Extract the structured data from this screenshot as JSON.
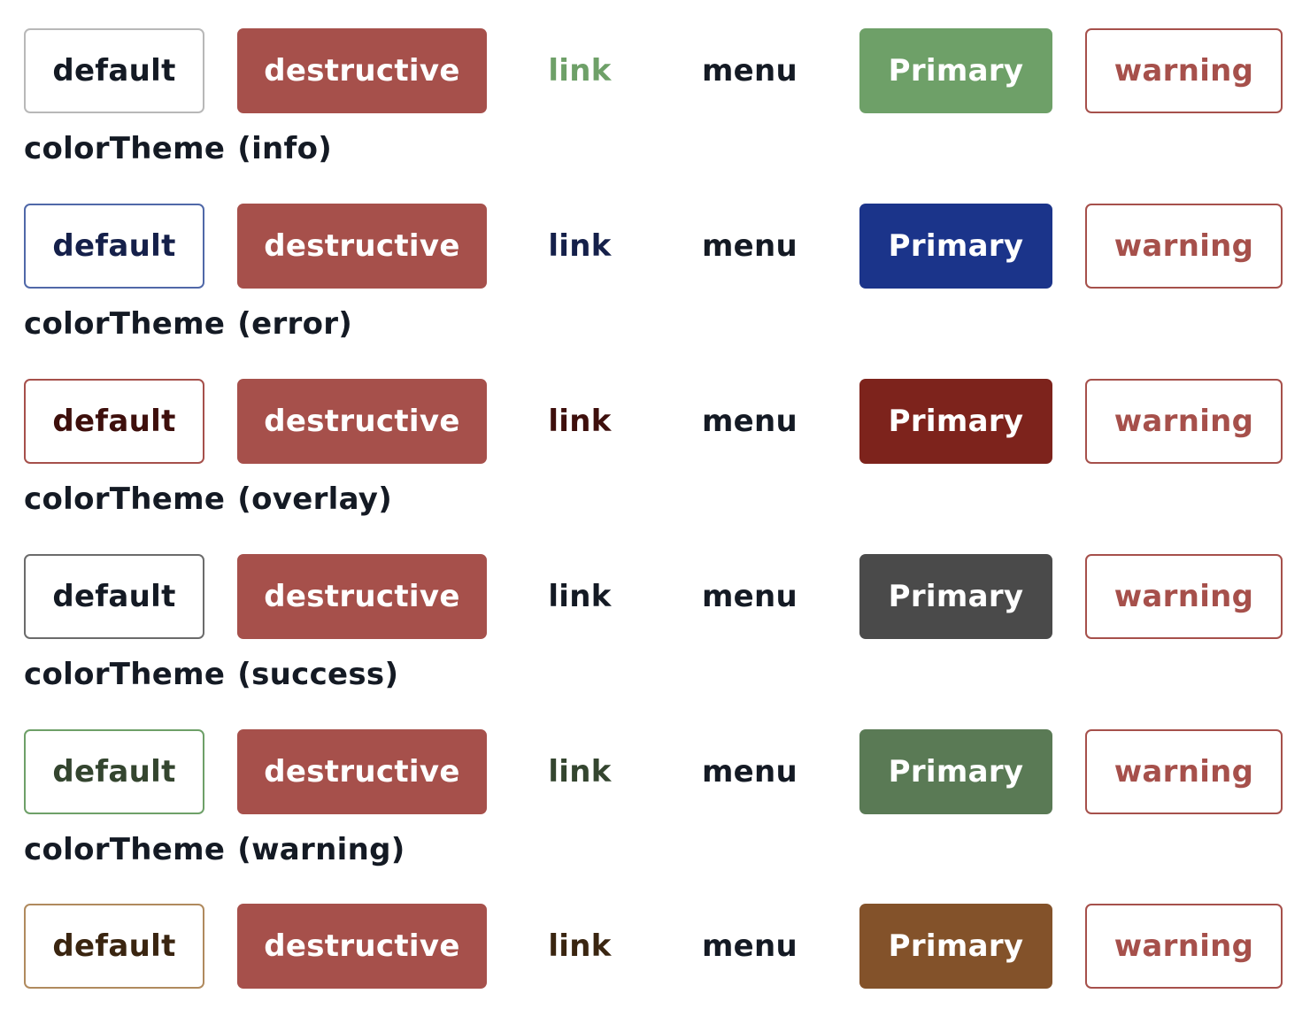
{
  "buttons": {
    "default": "default",
    "destructive": "destructive",
    "link": "link",
    "menu": "menu",
    "primary": "Primary",
    "warning": "warning"
  },
  "colors": {
    "destructive_bg": "#a6504b",
    "warning_accent": "#a6504b",
    "menu_text": "#141a24",
    "label_text": "#141a24"
  },
  "label_prefix": "colorTheme",
  "rows": [
    {
      "theme": "",
      "default_border": "#b8b8b8",
      "default_text": "#141a24",
      "link_text": "#6ea068",
      "primary_bg": "#6ea068"
    },
    {
      "theme": "(info)",
      "default_border": "#5068a8",
      "default_text": "#15204a",
      "link_text": "#15204a",
      "primary_bg": "#1b348a"
    },
    {
      "theme": "(error)",
      "default_border": "#a6504b",
      "default_text": "#3e0f0c",
      "link_text": "#3e0f0c",
      "primary_bg": "#7d231c"
    },
    {
      "theme": "(overlay)",
      "default_border": "#6b6b6b",
      "default_text": "#141a24",
      "link_text": "#141a24",
      "primary_bg": "#4a4a4a"
    },
    {
      "theme": "(success)",
      "default_border": "#6ea068",
      "default_text": "#34452f",
      "link_text": "#34452f",
      "primary_bg": "#5a7a55"
    },
    {
      "theme": "(warning)",
      "default_border": "#b08a5e",
      "default_text": "#3a2510",
      "link_text": "#3a2510",
      "primary_bg": "#83522a"
    }
  ]
}
